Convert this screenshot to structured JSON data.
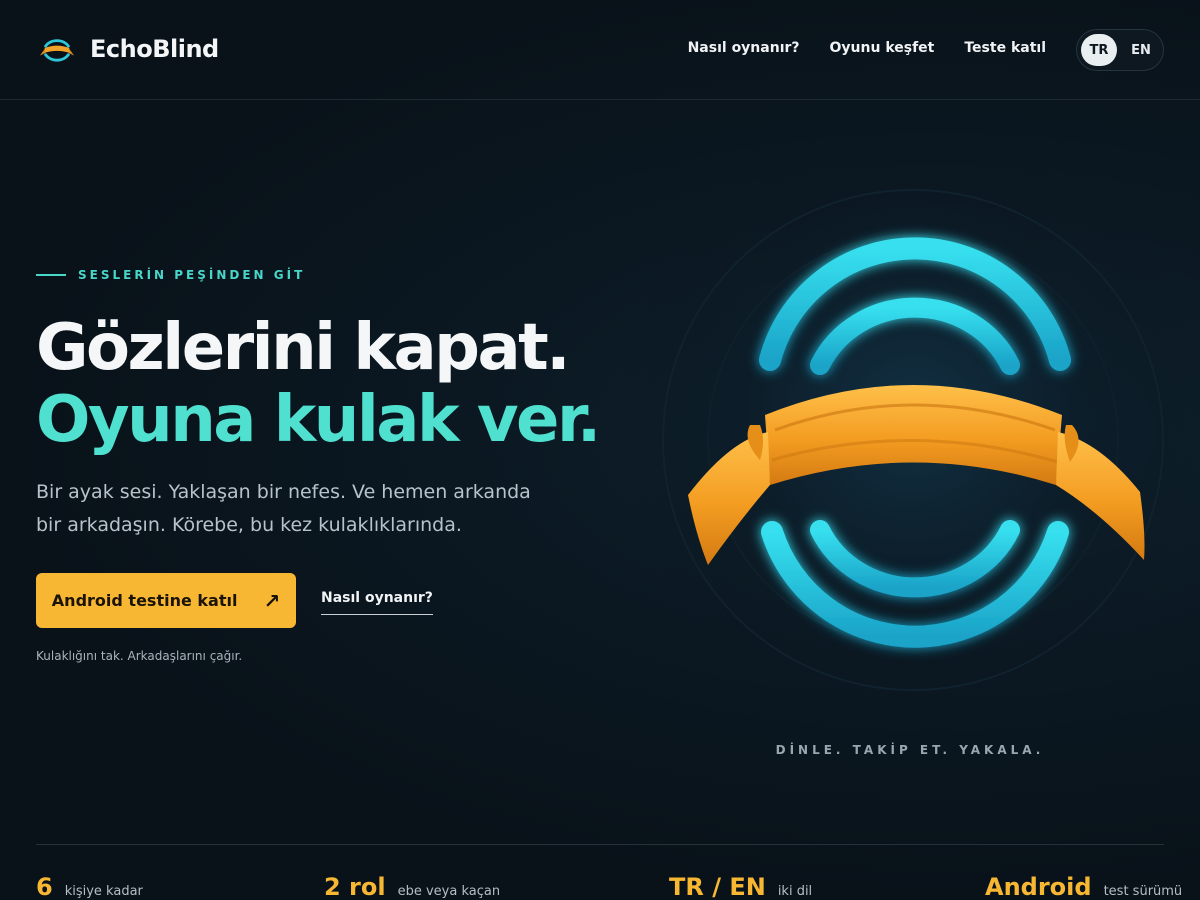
{
  "brand": {
    "name": "EchoBlind"
  },
  "nav": {
    "items": [
      {
        "label": "Nasıl oynanır?"
      },
      {
        "label": "Oyunu keşfet"
      },
      {
        "label": "Teste katıl"
      }
    ],
    "languages": {
      "active": "TR",
      "other": "EN"
    }
  },
  "hero": {
    "eyebrow": "SESLERİN PEŞİNDEN GİT",
    "title_line1": "Gözlerini kapat.",
    "title_line2": "Oyuna kulak ver.",
    "lead": "Bir ayak sesi. Yaklaşan bir nefes. Ve hemen arkanda bir arkadaşın. Körebe, bu kez kulaklıklarında.",
    "cta_label": "Android testine katıl",
    "cta_arrow": "↗",
    "secondary_label": "Nasıl oynanır?",
    "hint": "Kulaklığını tak. Arkadaşlarını çağır.",
    "tagline": "DİNLE. TAKİP ET. YAKALA."
  },
  "stats": [
    {
      "value": "6",
      "label": "kişiye kadar"
    },
    {
      "value": "2 rol",
      "label": "ebe veya kaçan"
    },
    {
      "value": "TR / EN",
      "label": "iki dil"
    },
    {
      "value": "Android",
      "label": "test sürümü"
    }
  ],
  "colors": {
    "accent_teal": "#4fe0cf",
    "accent_orange": "#f7b733",
    "background": "#0a141c"
  }
}
